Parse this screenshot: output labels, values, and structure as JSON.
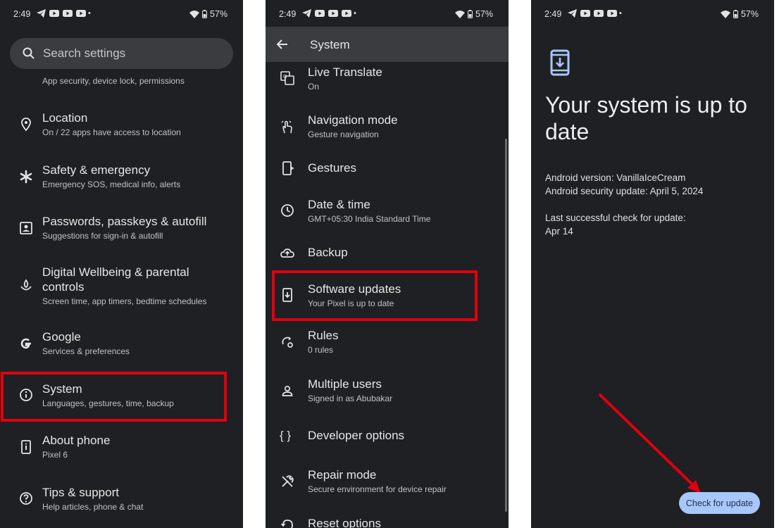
{
  "status": {
    "time": "2:49",
    "battery": "57%",
    "dot": "•"
  },
  "panel1": {
    "search_placeholder": "Search settings",
    "partial_sub": "App security, device lock, permissions",
    "items": [
      {
        "title": "Location",
        "sub": "On / 22 apps have access to location"
      },
      {
        "title": "Safety & emergency",
        "sub": "Emergency SOS, medical info, alerts"
      },
      {
        "title": "Passwords, passkeys & autofill",
        "sub": "Suggestions for sign-in & autofill"
      },
      {
        "title": "Digital Wellbeing & parental",
        "title2": "controls",
        "sub": "Screen time, app timers, bedtime schedules"
      },
      {
        "title": "Google",
        "sub": "Services & preferences"
      },
      {
        "title": "System",
        "sub": "Languages, gestures, time, backup"
      },
      {
        "title": "About phone",
        "sub": "Pixel 6"
      },
      {
        "title": "Tips & support",
        "sub": "Help articles, phone & chat"
      }
    ]
  },
  "panel2": {
    "header_title": "System",
    "items": [
      {
        "title": "Live Translate",
        "sub": "On"
      },
      {
        "title": "Navigation mode",
        "sub": "Gesture navigation"
      },
      {
        "title": "Gestures",
        "sub": ""
      },
      {
        "title": "Date & time",
        "sub": "GMT+05:30 India Standard Time"
      },
      {
        "title": "Backup",
        "sub": ""
      },
      {
        "title": "Software updates",
        "sub": "Your Pixel is up to date"
      },
      {
        "title": "Rules",
        "sub": "0 rules"
      },
      {
        "title": "Multiple users",
        "sub": "Signed in as Abubakar"
      },
      {
        "title": "Developer options",
        "sub": "",
        "icon_text": "{ }"
      },
      {
        "title": "Repair mode",
        "sub": "Secure environment for device repair"
      },
      {
        "title": "Reset options",
        "sub": ""
      }
    ]
  },
  "panel3": {
    "title": "Your system is up to date",
    "android_version": "Android version: VanillaIceCream",
    "security_update": "Android security update: April 5, 2024",
    "last_check_label": "Last successful check for update:",
    "last_check_date": "Apr 14",
    "button": "Check for update"
  },
  "colors": {
    "highlight": "#e0000f",
    "button_bg": "#a8c7fa",
    "panel_bg": "#1f2023"
  }
}
